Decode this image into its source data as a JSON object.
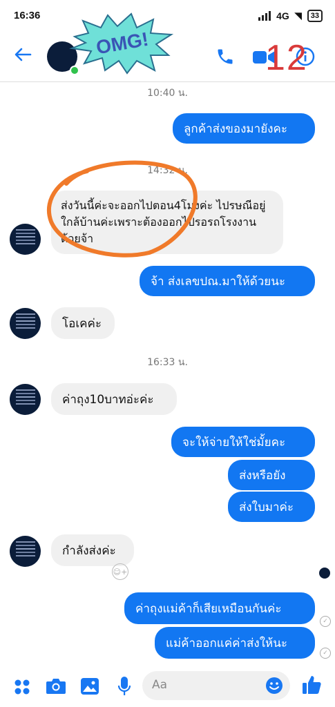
{
  "status_bar": {
    "time": "16:36",
    "network": "4G",
    "battery": "33"
  },
  "header": {
    "badge": "12",
    "sticker": "OMG!"
  },
  "timestamps": [
    "10:40 น.",
    "14:32 น.",
    "16:33 น."
  ],
  "messages": [
    {
      "text": "ลูกค้าส่งของมายังคะ",
      "sender": "me"
    },
    {
      "text": "ส่งวันนี้ค่ะจะออกไปตอน4โมงค่ะ ไปรษณีอยู่ใกล้บ้านค่ะเพราะต้องออกไปรอรถโรงงานด้วยจ้า",
      "sender": "them"
    },
    {
      "text": "จ้า ส่งเลขปณ.มาให้ด้วยนะ",
      "sender": "me"
    },
    {
      "text": "โอเคค่ะ",
      "sender": "them"
    },
    {
      "text": "ค่าถุง10บาทอ่ะค่ะ",
      "sender": "them"
    },
    {
      "text": "จะให้จ่ายให้ใช่มั้ยคะ",
      "sender": "me"
    },
    {
      "text": "ส่งหรือยัง",
      "sender": "me"
    },
    {
      "text": "ส่งใบมาค่ะ",
      "sender": "me"
    },
    {
      "text": "กำลังส่งค่ะ",
      "sender": "them"
    },
    {
      "text": "ค่าถุงแม่ค้าก็เสียเหมือนกันค่ะ",
      "sender": "me"
    },
    {
      "text": "แม่ค้าออกแค่ค่าส่งให้นะ",
      "sender": "me"
    }
  ],
  "composer": {
    "placeholder": "Aa"
  },
  "colors": {
    "accent": "#1277f2",
    "incoming": "#f0f0f0",
    "annotation": "#f07a2a",
    "badge": "#d93a3a",
    "sticker": "#6fe0d8"
  },
  "icons": [
    "back-arrow-icon",
    "phone-icon",
    "video-icon",
    "info-icon",
    "apps-grid-icon",
    "camera-icon",
    "gallery-icon",
    "microphone-icon",
    "emoji-icon",
    "like-thumb-icon",
    "add-reaction-icon",
    "seen-check-icon"
  ]
}
